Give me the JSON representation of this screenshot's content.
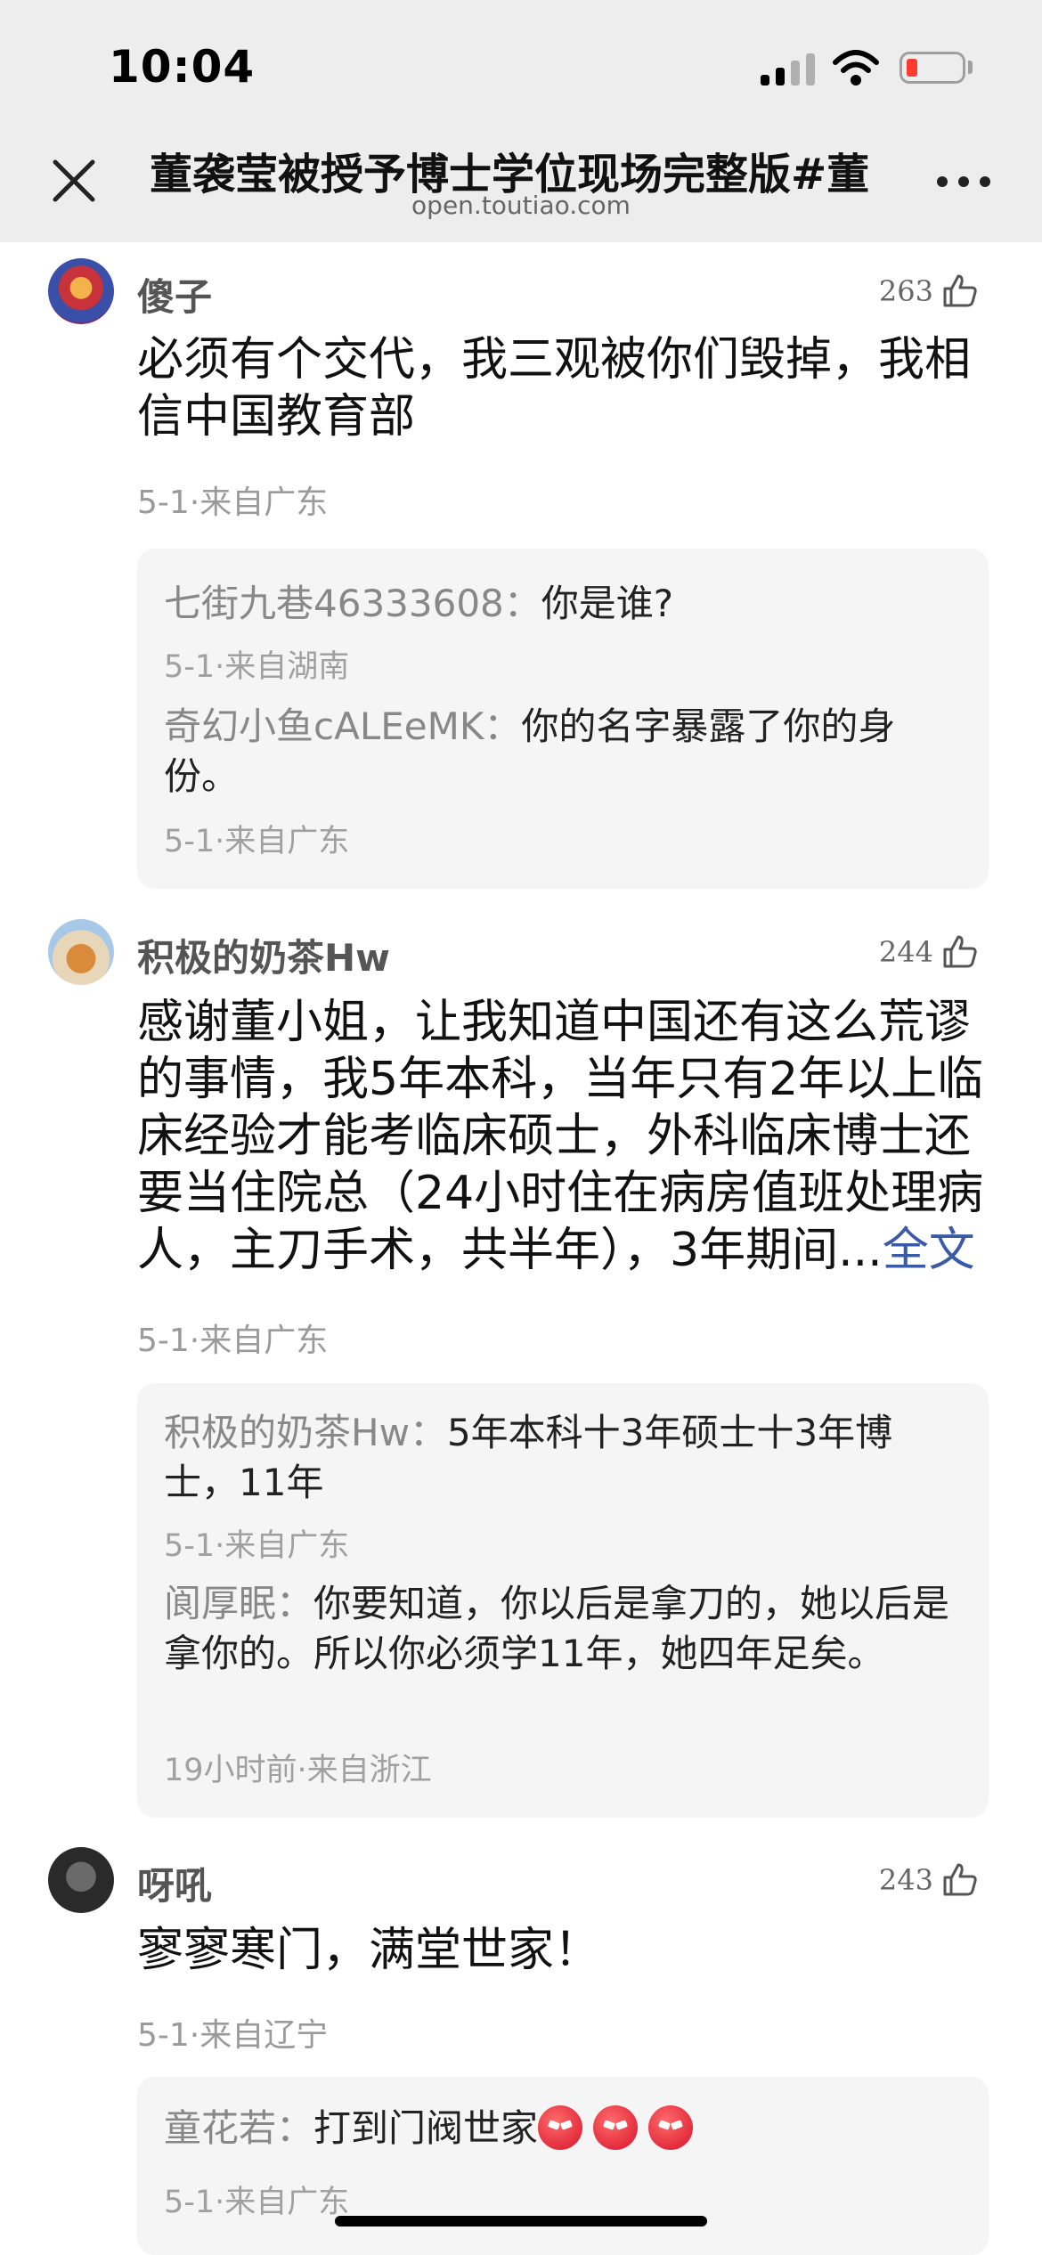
{
  "status_bar": {
    "time": "10:04"
  },
  "header": {
    "title": "董袭莹被授予博士学位现场完整版#董",
    "url": "open.toutiao.com"
  },
  "comments": [
    {
      "username": "傻子",
      "likes": "263",
      "text": "必须有个交代，我三观被你们毁掉，我相信中国教育部",
      "meta": "5-1·来自广东",
      "replies": [
        {
          "author": "七街九巷46333608：",
          "text": "你是谁?",
          "meta": "5-1·来自湖南"
        },
        {
          "author": "奇幻小鱼cALEeMK：",
          "text": "你的名字暴露了你的身份。",
          "meta": "5-1·来自广东"
        }
      ]
    },
    {
      "username": "积极的奶茶Hw",
      "likes": "244",
      "text": "感谢董小姐，让我知道中国还有这么荒谬的事情，我5年本科，当年只有2年以上临床经验才能考临床硕士，外科临床博士还要当住院总（24小时住在病房值班处理病人，主刀手术，共半年），3年期间...",
      "more_link": "全文",
      "meta": "5-1·来自广东",
      "replies": [
        {
          "author": "积极的奶茶Hw：",
          "text": "5年本科十3年硕士十3年博士，11年",
          "meta": "5-1·来自广东"
        },
        {
          "author": "阆厚眠：",
          "text": "你要知道，你以后是拿刀的，她以后是拿你的。所以你必须学11年，她四年足矣。",
          "meta": "19小时前·来自浙江"
        }
      ]
    },
    {
      "username": "呀吼",
      "likes": "243",
      "text": "寥寥寒门，满堂世家！",
      "meta": "5-1·来自辽宁",
      "replies": [
        {
          "author": "童花若：",
          "text": "打到门阀世家",
          "meta": "5-1·来自广东",
          "emoji_count": 3
        }
      ]
    }
  ],
  "icons": {
    "close": "close-icon",
    "more": "more-icon",
    "like": "thumbs-up-icon",
    "signal": "signal-icon",
    "wifi": "wifi-icon",
    "battery": "battery-icon"
  },
  "colors": {
    "link": "#3a5aa8",
    "battery_low": "#ff3b30",
    "header_bg": "#ededed",
    "reply_bg": "#f5f5f5"
  }
}
